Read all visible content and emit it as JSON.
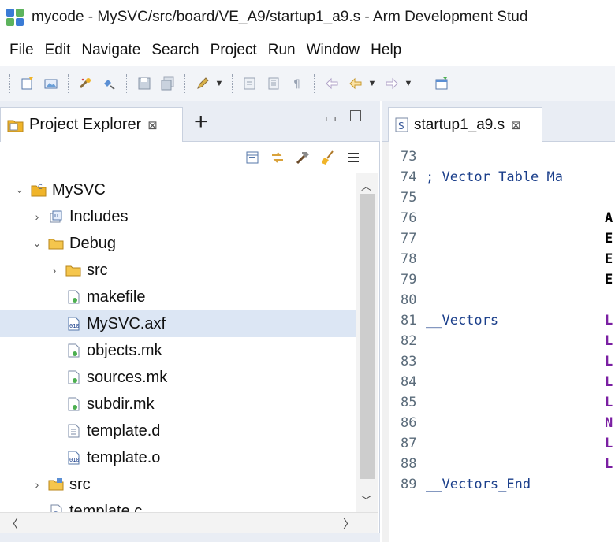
{
  "window": {
    "title": "mycode - MySVC/src/board/VE_A9/startup1_a9.s - Arm Development Stud"
  },
  "menu": [
    "File",
    "Edit",
    "Navigate",
    "Search",
    "Project",
    "Run",
    "Window",
    "Help"
  ],
  "project_explorer": {
    "tab_label": "Project Explorer",
    "tab_close": "⊠",
    "add_label": "+",
    "tree": [
      {
        "label": "MySVC",
        "twisty": "⌄",
        "icon": "project-icon",
        "indent": 0
      },
      {
        "label": "Includes",
        "twisty": "›",
        "icon": "includes-icon",
        "indent": 1
      },
      {
        "label": "Debug",
        "twisty": "⌄",
        "icon": "folder-icon",
        "indent": 1
      },
      {
        "label": "src",
        "twisty": "›",
        "icon": "folder-icon",
        "indent": 2
      },
      {
        "label": "makefile",
        "twisty": "",
        "icon": "makefile-icon",
        "indent": 2
      },
      {
        "label": "MySVC.axf",
        "twisty": "",
        "icon": "binary-file-icon",
        "indent": 2
      },
      {
        "label": "objects.mk",
        "twisty": "",
        "icon": "makefile-icon",
        "indent": 2
      },
      {
        "label": "sources.mk",
        "twisty": "",
        "icon": "makefile-icon",
        "indent": 2
      },
      {
        "label": "subdir.mk",
        "twisty": "",
        "icon": "makefile-icon",
        "indent": 2
      },
      {
        "label": "template.d",
        "twisty": "",
        "icon": "text-file-icon",
        "indent": 2
      },
      {
        "label": "template.o",
        "twisty": "",
        "icon": "binary-file-icon",
        "indent": 2
      },
      {
        "label": "src",
        "twisty": "›",
        "icon": "source-folder-icon",
        "indent": 1
      },
      {
        "label": "template.c",
        "twisty": "",
        "icon": "c-file-icon",
        "indent": 1
      }
    ]
  },
  "editor": {
    "tab_label": "startup1_a9.s",
    "tab_close": "⊠",
    "lines": [
      {
        "no": "73",
        "text": "",
        "op": "",
        "op_color": "#000000"
      },
      {
        "no": "74",
        "text": "; Vector Table Ma",
        "op": "",
        "op_color": "#000000"
      },
      {
        "no": "75",
        "text": "",
        "op": "",
        "op_color": "#000000"
      },
      {
        "no": "76",
        "text": "",
        "op": "A",
        "op_color": "#000000"
      },
      {
        "no": "77",
        "text": "",
        "op": "E",
        "op_color": "#000000"
      },
      {
        "no": "78",
        "text": "",
        "op": "E",
        "op_color": "#000000"
      },
      {
        "no": "79",
        "text": "",
        "op": "E",
        "op_color": "#000000"
      },
      {
        "no": "80",
        "text": "",
        "op": "",
        "op_color": "#000000"
      },
      {
        "no": "81",
        "text": "__Vectors",
        "op": "L",
        "op_color": "#7a1fa2"
      },
      {
        "no": "82",
        "text": "",
        "op": "L",
        "op_color": "#7a1fa2"
      },
      {
        "no": "83",
        "text": "",
        "op": "L",
        "op_color": "#7a1fa2"
      },
      {
        "no": "84",
        "text": "",
        "op": "L",
        "op_color": "#7a1fa2"
      },
      {
        "no": "85",
        "text": "",
        "op": "L",
        "op_color": "#7a1fa2"
      },
      {
        "no": "86",
        "text": "",
        "op": "N",
        "op_color": "#7a1fa2"
      },
      {
        "no": "87",
        "text": "",
        "op": "L",
        "op_color": "#7a1fa2"
      },
      {
        "no": "88",
        "text": "",
        "op": "L",
        "op_color": "#7a1fa2"
      },
      {
        "no": "89",
        "text": "__Vectors_End",
        "op": "",
        "op_color": "#000000"
      }
    ]
  },
  "colors": {
    "selection": "#dce6f4",
    "folder": "#f0b429",
    "code_text": "#1b3f8b",
    "line_number": "#5a6b7a"
  }
}
